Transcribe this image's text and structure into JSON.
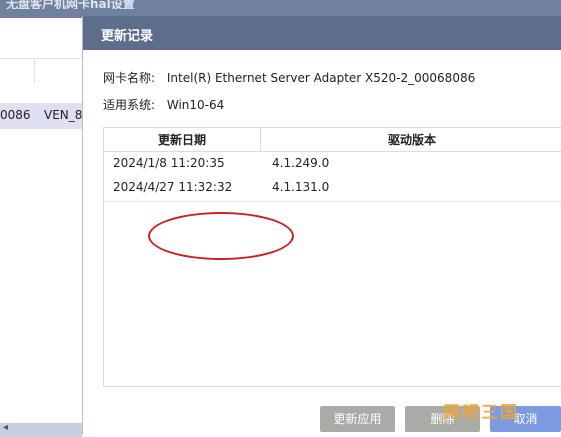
{
  "background_window": {
    "title": "无盘客户机网卡hal设置",
    "row": [
      "0086",
      "VEN_8"
    ]
  },
  "dialog": {
    "title": "更新记录",
    "adapter_label": "网卡名称:",
    "adapter_value": "Intel(R) Ethernet Server Adapter X520-2_00068086",
    "system_label": "适用系统:",
    "system_value": "Win10-64",
    "table": {
      "columns": [
        "更新日期",
        "驱动版本"
      ],
      "rows": [
        {
          "date": "2024/1/8 11:20:35",
          "version": "4.1.249.0"
        },
        {
          "date": "2024/4/27 11:32:32",
          "version": "4.1.131.0"
        }
      ]
    },
    "buttons": {
      "apply": "更新应用",
      "delete": "删除",
      "cancel": "取消"
    }
  },
  "watermark": "网吧三国",
  "colors": {
    "titlebar": "#5d6d8c",
    "annotation": "#c8201e",
    "primary_button": "#7d9be0",
    "disabled_button": "#a9aca6"
  }
}
